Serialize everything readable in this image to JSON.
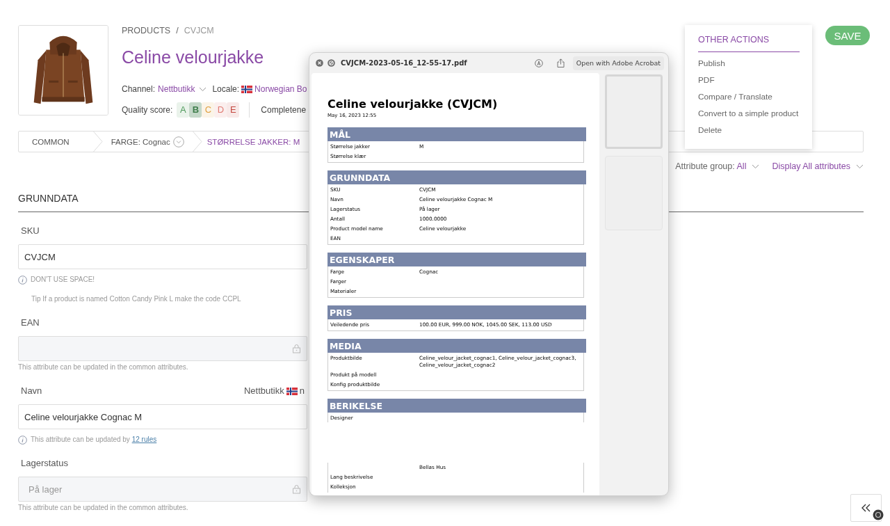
{
  "breadcrumb": {
    "items": [
      "PRODUCTS",
      "CVJCM"
    ],
    "separator": "/"
  },
  "product": {
    "title": "Celine velourjakke",
    "channel_label": "Channel:",
    "channel": "Nettbutikk",
    "locale_label": "Locale:",
    "locale": "Norwegian Bo",
    "quality_label": "Quality score:",
    "grades": [
      {
        "letter": "A",
        "color": "#4f9a5c",
        "selected": false
      },
      {
        "letter": "B",
        "color": "#3f7d4b",
        "selected": true
      },
      {
        "letter": "C",
        "color": "#e0a041",
        "selected": false
      },
      {
        "letter": "D",
        "color": "#e07a72",
        "selected": false
      },
      {
        "letter": "E",
        "color": "#c4473f",
        "selected": false
      }
    ],
    "completeness_label": "Completene"
  },
  "save_button": "SAVE",
  "variant_tabs": [
    {
      "label": "COMMON",
      "selected": false,
      "dropdown": false
    },
    {
      "label": "FARGE: Cognac",
      "selected": false,
      "dropdown": true
    },
    {
      "label": "STØRRELSE JAKKER: M",
      "selected": true,
      "dropdown": false
    }
  ],
  "filters": [
    {
      "label": "Attribute group:",
      "value": "All"
    },
    {
      "value": "Display All attributes"
    }
  ],
  "section": {
    "title": "GRUNNDATA",
    "fields": [
      {
        "label": "SKU",
        "value": "CVJCM",
        "locked": false,
        "notes": [
          {
            "kind": "info",
            "text": "DON'T USE SPACE!"
          },
          {
            "kind": "tip",
            "text": "Tip If a product is named Cotton Candy Pink L make the code CCPL"
          }
        ]
      },
      {
        "label": "EAN",
        "locked": true,
        "notes": [
          {
            "kind": "help",
            "text": "This attribute can be updated in the common attributes."
          }
        ]
      },
      {
        "label": "Navn",
        "scope_channel": "Nettbutikk",
        "scope_locale": "n",
        "value": "Celine velourjakke Cognac M",
        "locked": false,
        "notes": [
          {
            "kind": "info",
            "text": "This attribute can be updated by",
            "link": "12 rules"
          }
        ]
      },
      {
        "label": "Lagerstatus",
        "value": "På lager",
        "locked": true,
        "notes": [
          {
            "kind": "help",
            "text": "This attribute can be updated in the common attributes."
          }
        ]
      }
    ]
  },
  "actions_menu": {
    "title": "OTHER ACTIONS",
    "items": [
      "Publish",
      "PDF",
      "Compare / Translate",
      "Convert to a simple product",
      "Delete"
    ]
  },
  "pdf_viewer": {
    "filename": "CVJCM-2023-05-16_12-55-17.pdf",
    "open_button": "Open with Adobe Acrobat",
    "thumbnails": [
      {
        "selected": true
      },
      {
        "selected": false
      }
    ],
    "document": {
      "title": "Celine velourjakke (CVJCM)",
      "date": "May 16, 2023 12:55",
      "sections": [
        {
          "title": "MÅL",
          "rows": [
            {
              "label": "Størrelse jakker",
              "value": "M"
            },
            {
              "label": "Størrelse klær"
            }
          ]
        },
        {
          "title": "GRUNNDATA",
          "rows": [
            {
              "label": "SKU",
              "value": "CVJCM"
            },
            {
              "label": "Navn",
              "value": "Celine velourjakke Cognac M"
            },
            {
              "label": "Lagerstatus",
              "value": "På lager"
            },
            {
              "label": "Antall",
              "value": "1000.0000"
            },
            {
              "label": "Product model name",
              "value": "Celine velourjakke"
            },
            {
              "label": "EAN"
            }
          ]
        },
        {
          "title": "EGENSKAPER",
          "rows": [
            {
              "label": "Farge",
              "value": "Cognac"
            },
            {
              "label": "Farger"
            },
            {
              "label": "Materialer"
            }
          ]
        },
        {
          "title": "PRIS",
          "rows": [
            {
              "label": "Veiledende pris",
              "value": "100.00 EUR, 999.00 NOK, 1045.00 SEK, 113.00 USD"
            }
          ]
        },
        {
          "title": "MEDIA",
          "rows": [
            {
              "label": "Produktbilde",
              "value": "Celine_velour_jacket_cognac1, Celine_velour_jacket_cognac3, Celine_velour_jacket_cognac2"
            },
            {
              "label": "Produkt på modell"
            },
            {
              "label": "Konfig produktbilde"
            }
          ]
        },
        {
          "title": "BERIKELSE",
          "rows": [
            {
              "label": "Designer"
            }
          ],
          "continued_rows": [
            {
              "value": "Bellas Hus"
            },
            {
              "label": "Lang beskrivelse"
            },
            {
              "label": "Kolleksjon"
            }
          ]
        }
      ]
    }
  }
}
